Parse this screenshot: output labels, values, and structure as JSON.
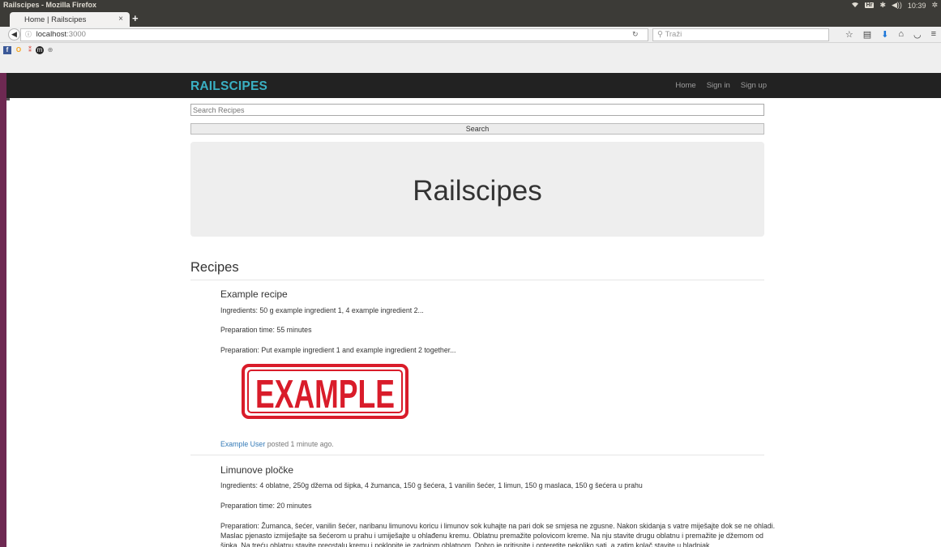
{
  "os": {
    "window_title": "Railscipes - Mozilla Firefox",
    "clock": "10:39",
    "keyboard_badge": "Hr",
    "tray_icons": [
      "wifi-icon",
      "bluetooth-icon",
      "volume-icon",
      "settings-icon"
    ]
  },
  "browser": {
    "tab_title": "Home | Railscipes",
    "tab_close": "×",
    "new_tab": "+",
    "url_host": "localhost",
    "url_port": ":3000",
    "search_placeholder": "Traži",
    "back_icon": "back-arrow-icon",
    "toolbar_icons": [
      "star-icon",
      "bookmarks-icon",
      "download-icon",
      "home-icon",
      "pocket-icon",
      "menu-icon"
    ]
  },
  "bookmarks": [
    "facebook-icon",
    "opera-icon",
    "dots-icon",
    "medium-icon",
    "globe-icon"
  ],
  "site": {
    "brand": "RAILSCIPES",
    "nav": {
      "home": "Home",
      "sign_in": "Sign in",
      "sign_up": "Sign up"
    },
    "search": {
      "placeholder": "Search Recipes",
      "button": "Search"
    },
    "hero_title": "Railscipes",
    "section_title": "Recipes",
    "recipes": [
      {
        "title": "Example recipe",
        "ingredients": "Ingredients: 50 g example ingredient 1, 4 example ingredient 2...",
        "prep_time": "Preparation time: 55 minutes",
        "preparation": "Preparation: Put example ingredient 1 and example ingredient 2 together...",
        "image_text": "EXAMPLE",
        "user": "Example User",
        "posted": " posted 1 minute ago."
      },
      {
        "title": "Limunove pločke",
        "ingredients": "Ingredients: 4 oblatne, 250g džema od šipka, 4 žumanca, 150 g šećera, 1 vanilin šećer, 1 limun, 150 g maslaca, 150 g šećera u prahu",
        "prep_time": "Preparation time: 20 minutes",
        "preparation": "Preparation: Žumanca, šećer, vanilin šećer, naribanu limunovu koricu i limunov sok kuhajte na pari dok se smjesa ne zgusne. Nakon skidanja s vatre miješajte dok se ne ohladi. Maslac pjenasto izmiješajte sa šećerom u prahu i umiješajte u ohlađenu kremu. Oblatnu premažite polovicom kreme. Na nju stavite drugu oblatnu i premažite je džemom od šipka. Na treću oblatnu stavite preostalu kremu i poklopite je zadnjom oblatnom. Dobro je pritisnite i opteretite nekoliko sati, a zatim kolač stavite u hladnjak."
      }
    ]
  }
}
